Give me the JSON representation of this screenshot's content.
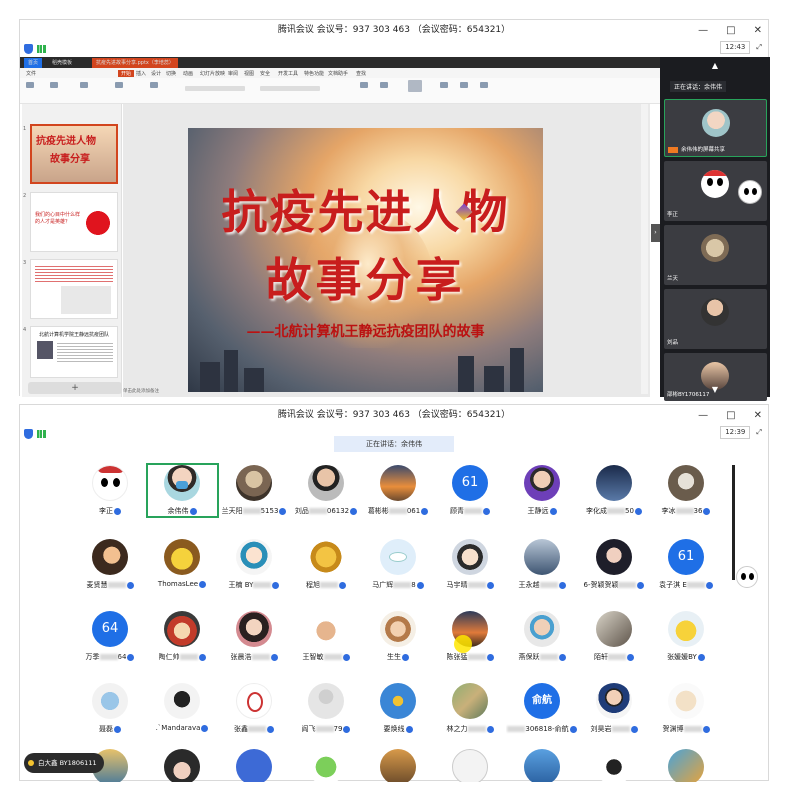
{
  "window1": {
    "title": "腾讯会议 会议号：937 303 463 （会议密码：654321）",
    "time": "12:43",
    "controls": {
      "minimize": "—",
      "maximize": "□",
      "close": "✕"
    }
  },
  "window2": {
    "title": "腾讯会议 会议号：937 303 463 （会议密码：654321）",
    "time": "12:39",
    "controls": {
      "minimize": "—",
      "maximize": "□",
      "close": "✕"
    }
  },
  "ppt": {
    "tabs": [
      "首页",
      "稻壳模板",
      "抗疫先进故事分享.pptx（李培蕊）"
    ],
    "menu": [
      "文件",
      "开始",
      "插入",
      "设计",
      "切换",
      "动画",
      "幻灯片放映",
      "审阅",
      "视图",
      "安全",
      "开发工具",
      "特色功能",
      "文档助手",
      "查找"
    ],
    "slide_title_1": "抗疫先进人物",
    "slide_title_2": "故事分享",
    "slide_subtitle": "——北航计算机王静远抗疫团队的故事",
    "notes_placeholder": "单击此处添加备注",
    "thumbnails": [
      "1",
      "2",
      "3",
      "4"
    ],
    "thumb_texts": {
      "t1_title": "抗疫先进人物",
      "t1_sub": "故事分享",
      "t2_text": "我们的心目中什么样的人才是英雄？",
      "t4_title": "北航计算机学院王静远抗疫团队"
    }
  },
  "video_panel": {
    "speaking": "正在讲话：余伟伟",
    "tiles": [
      {
        "name": "余伟伟的屏幕共享"
      },
      {
        "name": "李正"
      },
      {
        "name": "兰天"
      },
      {
        "name": "刘品"
      },
      {
        "name": "邵彬BY1706117"
      }
    ]
  },
  "grid_speaking": "正在讲话：余伟伟",
  "participants_row1": [
    {
      "name": "李正",
      "avatar": "dog-emoji"
    },
    {
      "name": "余伟伟",
      "avatar": "photo-mask"
    },
    {
      "name": "兰天阳",
      "tail": "5153",
      "avatar": "photo"
    },
    {
      "name": "刘品",
      "tail": "06132",
      "avatar": "photo"
    },
    {
      "name": "葛彬彬",
      "tail": "061",
      "avatar": "photo"
    },
    {
      "name": "顾青",
      "num": "61",
      "avatar": "number"
    },
    {
      "name": "王静远",
      "avatar": "photo"
    },
    {
      "name": "李化成",
      "tail": "50",
      "avatar": "photo"
    },
    {
      "name": "李冰",
      "tail": "36",
      "avatar": "photo"
    }
  ],
  "participants_row2": [
    {
      "name": "麦贤慧",
      "avatar": "photo"
    },
    {
      "name": "ThomasLee",
      "avatar": "photo"
    },
    {
      "name": "王楠 BY",
      "avatar": "photo"
    },
    {
      "name": "程旭",
      "avatar": "photo"
    },
    {
      "name": "马广辉",
      "tail": "8",
      "avatar": "photo"
    },
    {
      "name": "马宇晴",
      "avatar": "photo"
    },
    {
      "name": "王永越",
      "avatar": "photo"
    },
    {
      "name": "6-贺颖贺颖",
      "avatar": "photo"
    },
    {
      "name": "袁子淇 E",
      "num": "61",
      "avatar": "number"
    }
  ],
  "participants_row3": [
    {
      "name": "万季",
      "tail": "64",
      "num": "64",
      "avatar": "number"
    },
    {
      "name": "陶仁帅",
      "avatar": "photo"
    },
    {
      "name": "张晨浩",
      "avatar": "photo"
    },
    {
      "name": "王智敏",
      "avatar": "photo"
    },
    {
      "name": "生生",
      "avatar": "photo"
    },
    {
      "name": "陈张猛",
      "avatar": "photo"
    },
    {
      "name": "燕保跃",
      "avatar": "photo"
    },
    {
      "name": "陌轩",
      "avatar": "photo"
    },
    {
      "name": "张媛媛BY",
      "avatar": "photo"
    }
  ],
  "participants_row4": [
    {
      "name": "聂磊",
      "avatar": "photo"
    },
    {
      "name": ".`Mandarava",
      "avatar": "photo"
    },
    {
      "name": "张鑫",
      "avatar": "photo"
    },
    {
      "name": "阎飞",
      "tail": "79",
      "avatar": "default"
    },
    {
      "name": "要焕线",
      "avatar": "photo"
    },
    {
      "name": "林之力",
      "avatar": "photo"
    },
    {
      "name": "",
      "tail": "306818-俞航",
      "text_avatar": "俞航",
      "avatar": "text"
    },
    {
      "name": "刘昊岩",
      "avatar": "photo"
    },
    {
      "name": "贺渊博",
      "avatar": "photo"
    }
  ],
  "mic_toast": "白大鑫 BY1806111",
  "colors": {
    "accent": "#1f6fe6",
    "speaking_border": "#28a35b",
    "title_red": "#c81d1d"
  }
}
